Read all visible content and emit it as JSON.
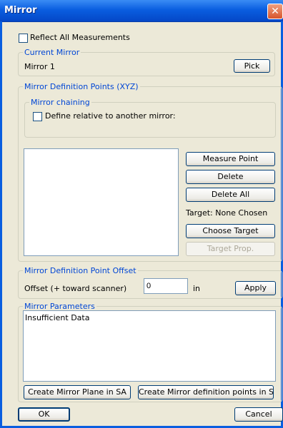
{
  "window": {
    "title": "Mirror",
    "close_icon": "close-icon"
  },
  "reflect_all": {
    "label": "Reflect All Measurements",
    "checked": false
  },
  "current_mirror": {
    "legend": "Current Mirror",
    "value": "Mirror 1",
    "pick_label": "Pick"
  },
  "definition_points": {
    "legend": "Mirror Definition Points (XYZ)",
    "chaining": {
      "legend": "Mirror chaining",
      "relative_label": "Define relative to another mirror:",
      "checked": false
    },
    "points": [],
    "measure_label": "Measure Point",
    "delete_label": "Delete",
    "delete_all_label": "Delete All",
    "target_text": "Target: None Chosen",
    "choose_target_label": "Choose Target",
    "target_prop_label": "Target Prop."
  },
  "offset": {
    "legend": "Mirror Definition Point Offset",
    "label": "Offset (+ toward scanner)",
    "value": "0",
    "unit": "in",
    "apply_label": "Apply"
  },
  "parameters": {
    "legend": "Mirror Parameters",
    "text": "Insufficient Data",
    "create_plane_label": "Create Mirror Plane in SA",
    "create_points_label": "Create Mirror definition points in SA"
  },
  "footer": {
    "ok_label": "OK",
    "cancel_label": "Cancel"
  }
}
